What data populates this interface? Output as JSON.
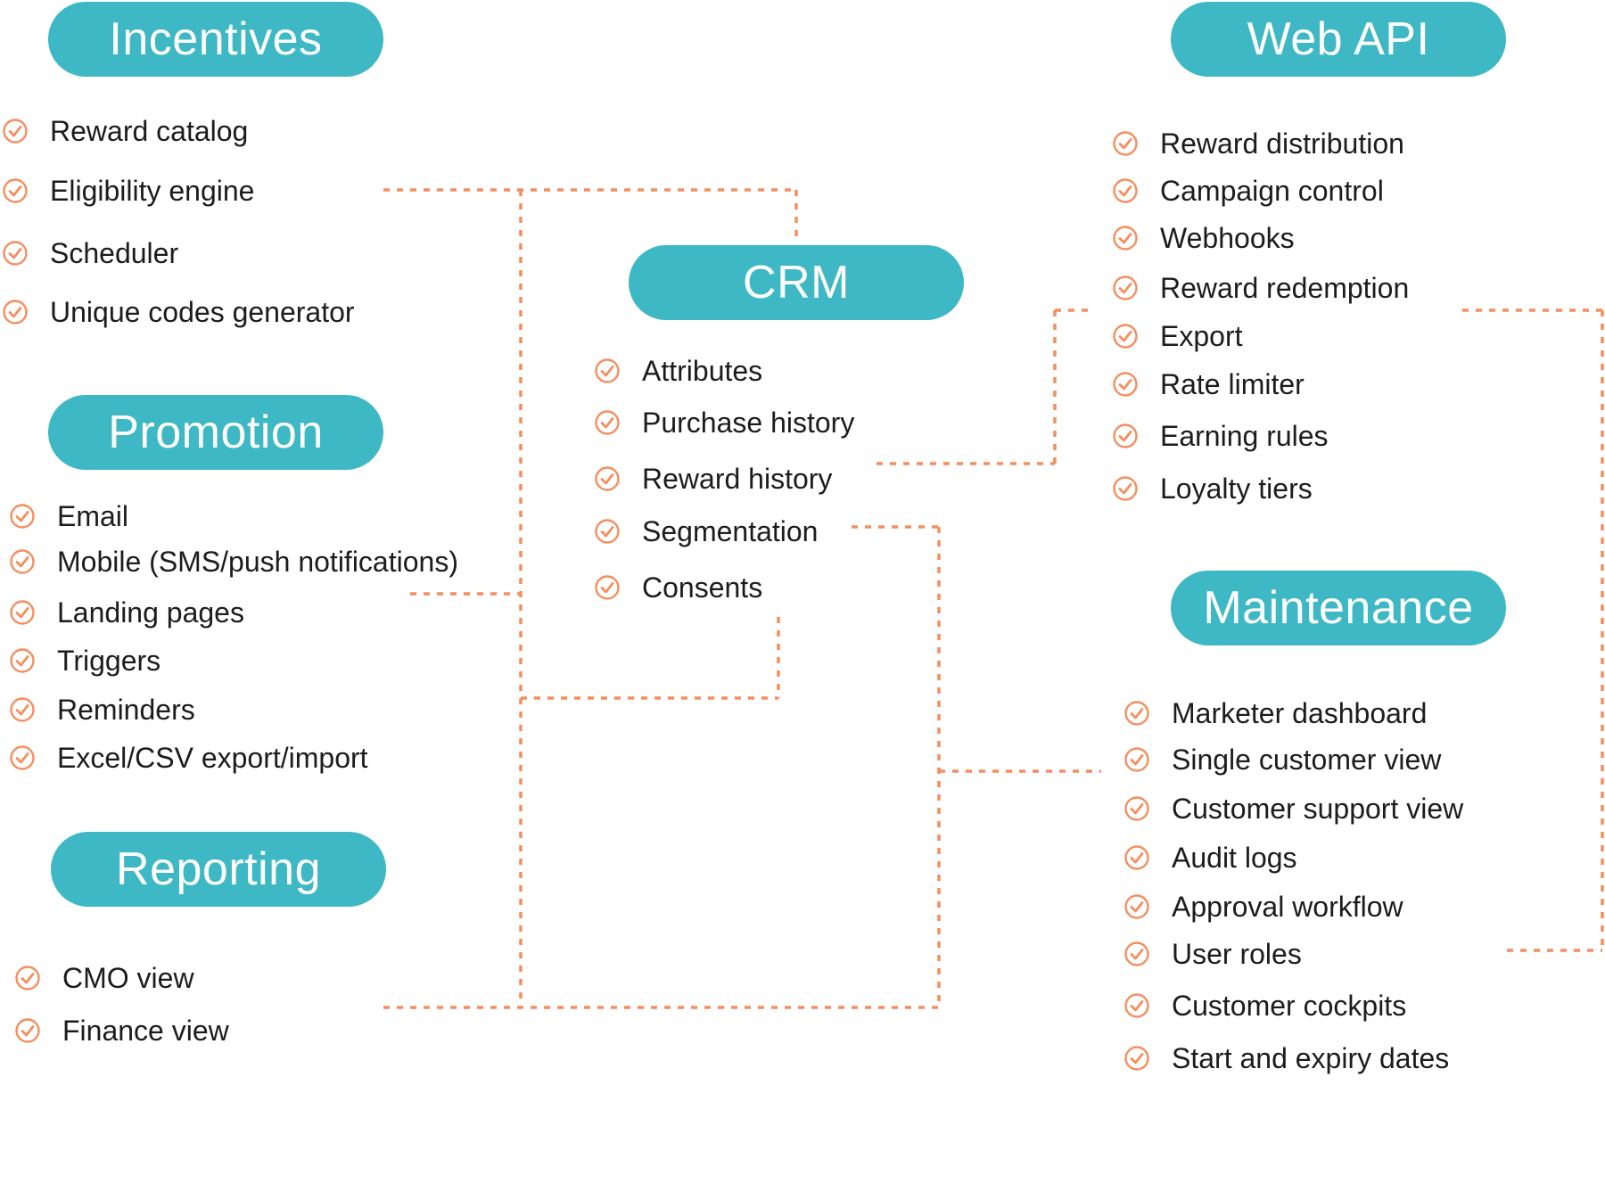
{
  "colors": {
    "pill": "#3db8c4",
    "accent": "#f58e5f",
    "text": "#1c1c1c"
  },
  "icon": "check-circle-icon",
  "groups": {
    "incentives": {
      "title": "Incentives",
      "items": [
        "Reward catalog",
        "Eligibility engine",
        "Scheduler",
        "Unique codes generator"
      ]
    },
    "promotion": {
      "title": "Promotion",
      "items": [
        "Email",
        "Mobile (SMS/push notifications)",
        "Landing pages",
        "Triggers",
        "Reminders",
        "Excel/CSV export/import"
      ]
    },
    "reporting": {
      "title": "Reporting",
      "items": [
        "CMO view",
        "Finance view"
      ]
    },
    "crm": {
      "title": "CRM",
      "items": [
        "Attributes",
        "Purchase history",
        "Reward history",
        "Segmentation",
        "Consents"
      ]
    },
    "webapi": {
      "title": "Web API",
      "items": [
        "Reward distribution",
        "Campaign control",
        "Webhooks",
        "Reward redemption",
        "Export",
        "Rate limiter",
        "Earning rules",
        "Loyalty tiers"
      ]
    },
    "maintenance": {
      "title": "Maintenance",
      "items": [
        "Marketer dashboard",
        "Single customer view",
        "Customer support view",
        "Audit logs",
        "Approval workflow",
        "User roles",
        "Customer cockpits",
        "Start and expiry dates"
      ]
    }
  }
}
